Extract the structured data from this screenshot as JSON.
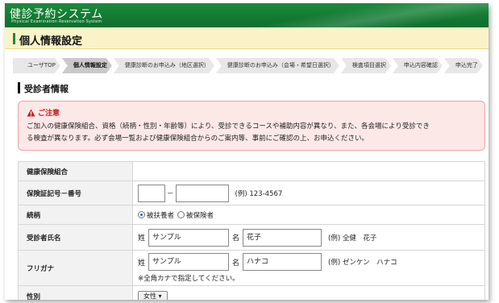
{
  "header": {
    "logo_main": "健診予約システム",
    "logo_sub": "Physical Examination Reservation System"
  },
  "page_title": "個人情報設定",
  "breadcrumb": [
    "ユーザTOP",
    "個人情報設定",
    "健康診断のお申込み（地区選択）",
    "健康診断のお申込み（会場・希望日選択）",
    "検査項目選択",
    "申込内容確認",
    "申込完了"
  ],
  "breadcrumb_active_index": 1,
  "section_title": "受診者情報",
  "notice": {
    "title": "ご注意",
    "line1": "ご加入の健康保険組合、資格（続柄・性別・年齢等）により、受診できるコースや補助内容が異なり、また、各会場により受診でき",
    "line2": "る検査が異なります。必ず会場一覧および健康保険組合からのご案内等、事前にご確認の上、お申込ください。"
  },
  "form": {
    "insurer": {
      "label": "健康保険組合",
      "value": ""
    },
    "insurance_number": {
      "label": "保険証記号－番号",
      "part1": "",
      "separator": "－",
      "part2": "",
      "example": "(例) 123-4567"
    },
    "relationship": {
      "label": "続柄",
      "options": [
        "被扶養者",
        "被保険者"
      ],
      "selected": "被扶養者"
    },
    "name": {
      "label": "受診者氏名",
      "last_label": "姓",
      "last_value": "サンプル",
      "first_label": "名",
      "first_value": "花子",
      "example": "(例) 全健　花子"
    },
    "kana": {
      "label": "フリガナ",
      "last_label": "姓",
      "last_value": "サンプル",
      "first_label": "名",
      "first_value": "ハナコ",
      "example": "(例) ゼンケン　ハナコ",
      "note": "※全角カナで指定してください。"
    },
    "gender": {
      "label": "性別",
      "selected": "女性"
    }
  },
  "colors": {
    "header_green": "#1b8a3c",
    "title_band": "#fbf3c8",
    "notice_bg": "#fde8e8",
    "notice_title": "#c71c1c",
    "radio_selected": "#2a64c4"
  }
}
